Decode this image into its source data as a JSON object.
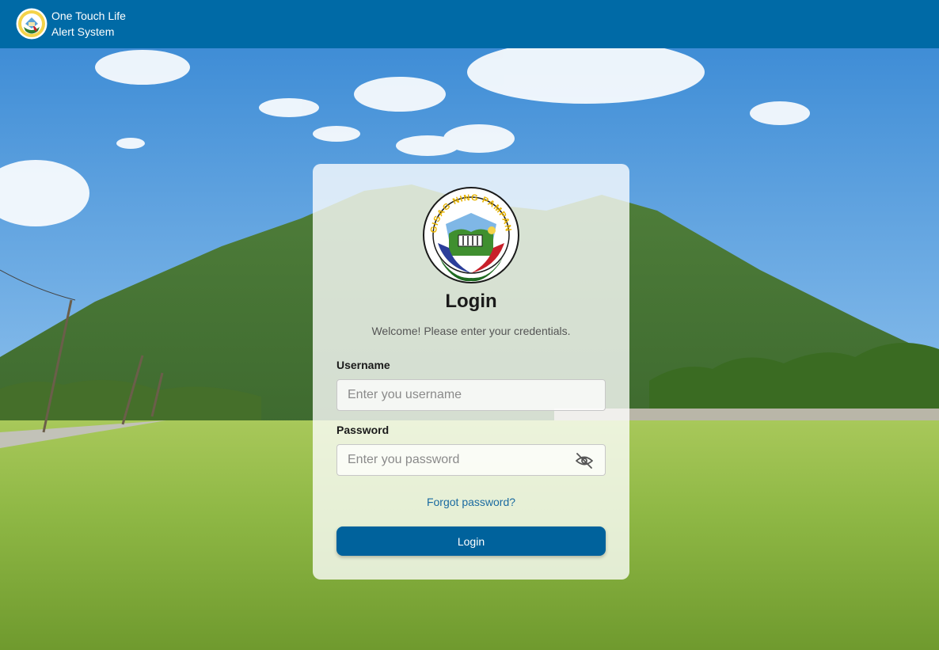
{
  "header": {
    "title_line1": "One Touch Life",
    "title_line2": "Alert System"
  },
  "login": {
    "heading": "Login",
    "welcome": "Welcome! Please enter your credentials.",
    "username_label": "Username",
    "username_placeholder": "Enter you username",
    "password_label": "Password",
    "password_placeholder": "Enter you password",
    "forgot_link": "Forgot password?",
    "submit_label": "Login"
  },
  "seal": {
    "text": "SAGISAG NING PAMPANGA"
  },
  "icons": {
    "password_toggle": "eye-off-icon",
    "header_logo": "provincial-seal-logo"
  },
  "colors": {
    "header_bg": "#006aa6",
    "button_bg": "#00629c",
    "link": "#1a6aa0"
  }
}
